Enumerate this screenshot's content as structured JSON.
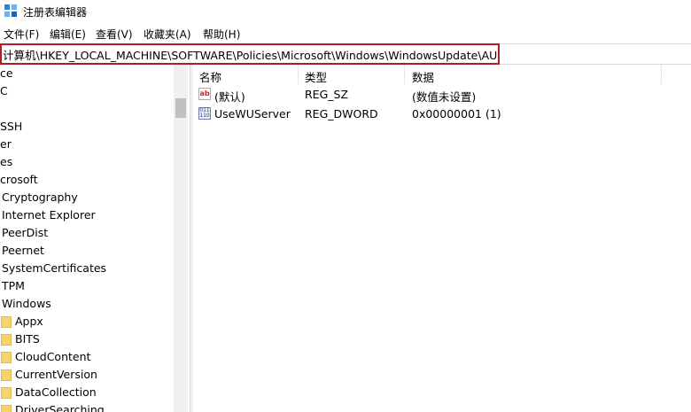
{
  "window": {
    "title": "注册表编辑器"
  },
  "menu": [
    "文件(F)",
    "编辑(E)",
    "查看(V)",
    "收藏夹(A)",
    "帮助(H)"
  ],
  "address": {
    "path": "计算机\\HKEY_LOCAL_MACHINE\\SOFTWARE\\Policies\\Microsoft\\Windows\\WindowsUpdate\\AU"
  },
  "tree": {
    "items": [
      {
        "label": "ce",
        "folder": false
      },
      {
        "label": "C",
        "folder": false
      },
      {
        "label": "",
        "folder": false
      },
      {
        "label": "SSH",
        "folder": false
      },
      {
        "label": "er",
        "folder": false
      },
      {
        "label": "es",
        "folder": false
      },
      {
        "label": "crosoft",
        "folder": false
      },
      {
        "label": "Cryptography",
        "folder": false
      },
      {
        "label": "Internet Explorer",
        "folder": false
      },
      {
        "label": "PeerDist",
        "folder": false
      },
      {
        "label": "Peernet",
        "folder": false
      },
      {
        "label": "SystemCertificates",
        "folder": false
      },
      {
        "label": "TPM",
        "folder": false
      },
      {
        "label": "Windows",
        "folder": false
      },
      {
        "label": "Appx",
        "folder": true
      },
      {
        "label": "BITS",
        "folder": true
      },
      {
        "label": "CloudContent",
        "folder": true
      },
      {
        "label": "CurrentVersion",
        "folder": true
      },
      {
        "label": "DataCollection",
        "folder": true
      },
      {
        "label": "DriverSearching",
        "folder": true
      }
    ]
  },
  "list": {
    "columns": [
      "名称",
      "类型",
      "数据"
    ],
    "rows": [
      {
        "icon": "string-value-icon",
        "name": "(默认)",
        "type": "REG_SZ",
        "data": "(数值未设置)"
      },
      {
        "icon": "dword-value-icon",
        "name": "UseWUServer",
        "type": "REG_DWORD",
        "data": "0x00000001 (1)"
      }
    ]
  },
  "colors": {
    "highlight_border": "#b71c1c",
    "folder": "#f6d36b"
  }
}
